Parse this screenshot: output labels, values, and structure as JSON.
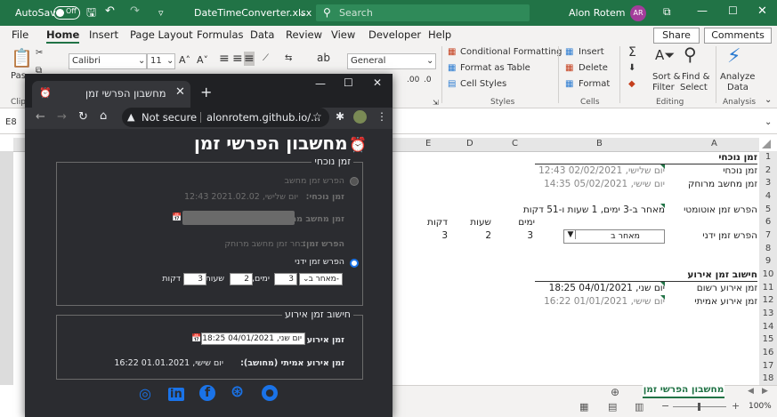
{
  "excel": {
    "autosave_label": "AutoSave",
    "autosave_state": "Off",
    "file_title": "DateTimeConverter.xlsx",
    "file_title_suffix": "⌄",
    "search_placeholder": "Search",
    "user_name": "Alon Rotem",
    "user_initials": "AR",
    "menu": [
      "File",
      "Home",
      "Insert",
      "Page Layout",
      "Formulas",
      "Data",
      "Review",
      "View",
      "Developer",
      "Help"
    ],
    "share_label": "Share",
    "comments_label": "Comments",
    "ribbon": {
      "font_name": "Calibri",
      "font_size": "11",
      "number_format": "General",
      "cond_format": "Conditional Formatting",
      "format_table": "Format as Table",
      "cell_styles": "Cell Styles",
      "insert": "Insert",
      "delete": "Delete",
      "format": "Format",
      "sort_filter_1": "Sort &",
      "sort_filter_2": "Filter",
      "find_select_1": "Find &",
      "find_select_2": "Select",
      "analyze_1": "Analyze",
      "analyze_2": "Data",
      "group_styles": "Styles",
      "group_cells": "Cells",
      "group_editing": "Editing",
      "group_analysis": "Analysis",
      "clip_partial": "Clip",
      "paste_partial": "Pas",
      "r_partial": "r"
    },
    "cell_ref": "E8",
    "columns": [
      "A",
      "B",
      "C",
      "D",
      "E"
    ],
    "rows": [
      "1",
      "2",
      "3",
      "4",
      "5",
      "6",
      "7",
      "8",
      "9",
      "10",
      "11",
      "12",
      "13",
      "14",
      "15",
      "16",
      "17",
      "18"
    ],
    "cells": {
      "a1": "זמן נוכחי",
      "a2": "זמן נוכחי",
      "b2": "יום שלישי, 02/02/2021 12:43",
      "a3": "זמן מחשב מרוחק",
      "b3": "יום שישי, 05/02/2021 14:35",
      "a5": "הפרש זמן אוטומטי",
      "b5": "מאחר ב-3 ימים, 1 שעות ו-51 דקות",
      "c6": "ימים",
      "d6": "שעות",
      "e6": "דקות",
      "a7": "הפרש זמן ידני",
      "b7": "מאחר ב",
      "c7": "3",
      "d7": "2",
      "e7": "3",
      "a10": "חישוב זמן אירוע",
      "a11": "זמן אירוע רשום",
      "b11": "יום שני, 04/01/2021 18:25",
      "a12": "זמן אירוע אמיתי",
      "b12": "יום שישי, 01/01/2021 16:22"
    },
    "sheet_tab": "מחשבון הפרשי זמן",
    "zoom": "100%"
  },
  "chrome": {
    "tab_title": "מחשבון הפרשי זמן",
    "not_secure": "Not secure",
    "url": "alonrotem.github.io/...",
    "page_title": "מחשבון הפרשי זמן",
    "current_time": {
      "legend": "זמן נוכחי",
      "radio_calc": "הפרש זמן מחשב",
      "now_label": "זמן נוכחי:",
      "now_value": "יום שלישי, 2021.02.02 12:43",
      "remote_label": "זמן מחשב מרוחק:",
      "diff_label": "הפרש זמן:",
      "diff_value": "בחר זמן מחשב מרוחק",
      "radio_manual": "הפרש זמן ידני",
      "direction": "מאחר ב-",
      "days_value": "3",
      "days_unit": "ימים,",
      "hours_value": "2",
      "hours_unit": "שעות,",
      "minutes_value": "3",
      "minutes_unit": "דקות"
    },
    "event": {
      "legend": "חישוב זמן אירוע",
      "recorded_label": "זמן אירוע רשום:",
      "recorded_value": "יום שני, 04/01/2021 18:25",
      "actual_label": "זמן אירוע אמיתי (מחושב):",
      "actual_value": "יום שישי, 01.01.2021 16:22"
    },
    "social_icons": [
      "instagram-icon",
      "linkedin-icon",
      "facebook-icon",
      "dribbble-icon",
      "github-icon"
    ]
  },
  "colors": {
    "excel_green": "#217346",
    "chrome_dark": "#202124",
    "link_blue": "#1a73e8"
  }
}
